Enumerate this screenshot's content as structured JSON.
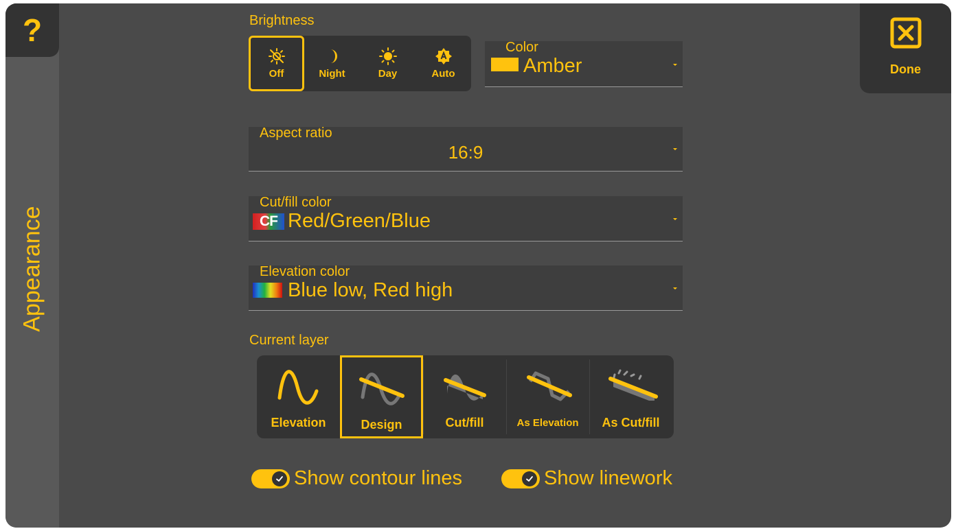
{
  "sidebar": {
    "help_label": "?",
    "title": "Appearance"
  },
  "done": {
    "label": "Done"
  },
  "brightness": {
    "label": "Brightness",
    "options": [
      {
        "label": "Off",
        "icon": "brightness-off-icon",
        "selected": true
      },
      {
        "label": "Night",
        "icon": "moon-icon",
        "selected": false
      },
      {
        "label": "Day",
        "icon": "sun-icon",
        "selected": false
      },
      {
        "label": "Auto",
        "icon": "auto-brightness-icon",
        "selected": false
      }
    ]
  },
  "color": {
    "label": "Color",
    "value": "Amber",
    "swatch": "#FFC20E"
  },
  "aspect_ratio": {
    "label": "Aspect ratio",
    "value": "16:9"
  },
  "cut_fill_color": {
    "label": "Cut/fill color",
    "value": "Red/Green/Blue",
    "icon_text": "CF"
  },
  "elevation_color": {
    "label": "Elevation color",
    "value": "Blue low, Red high"
  },
  "current_layer": {
    "label": "Current layer",
    "options": [
      {
        "label": "Elevation",
        "icon": "elevation-wave-icon",
        "selected": false
      },
      {
        "label": "Design",
        "icon": "design-icon",
        "selected": true
      },
      {
        "label": "Cut/fill",
        "icon": "cut-fill-icon",
        "selected": false
      },
      {
        "label": "As Elevation",
        "icon": "as-elevation-icon",
        "selected": false
      },
      {
        "label": "As Cut/fill",
        "icon": "as-cut-fill-icon",
        "selected": false
      }
    ]
  },
  "toggles": {
    "contour": {
      "label": "Show contour lines",
      "on": true
    },
    "linework": {
      "label": "Show linework",
      "on": true
    }
  },
  "colors": {
    "accent": "#FFC20E",
    "panel": "#4a4a4a",
    "dark": "#333333",
    "sidebar": "#595959"
  }
}
